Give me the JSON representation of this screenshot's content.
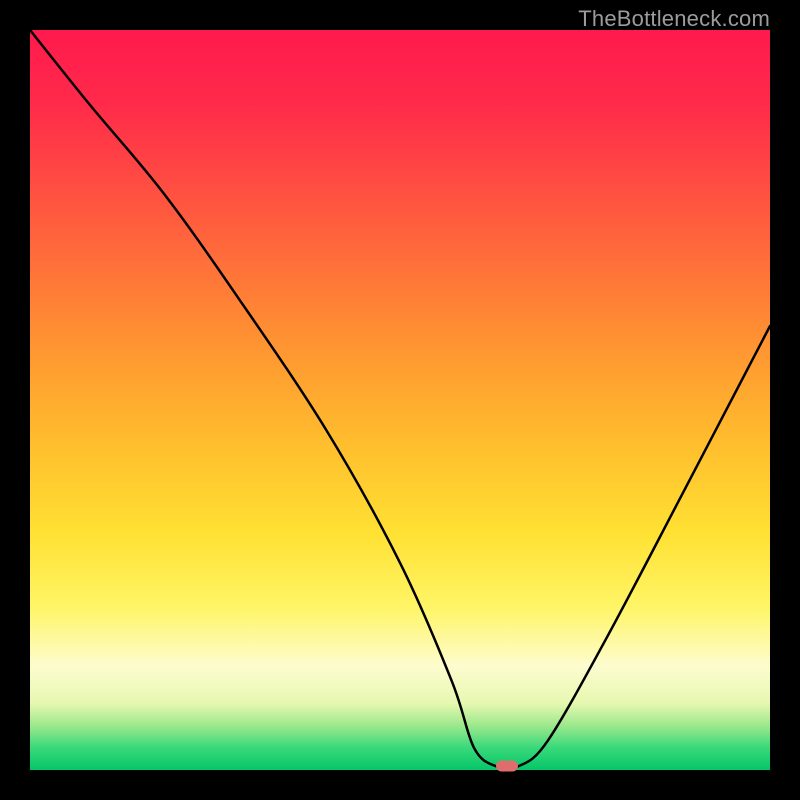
{
  "watermark": "TheBottleneck.com",
  "chart_data": {
    "type": "line",
    "title": "",
    "xlabel": "",
    "ylabel": "",
    "xlim": [
      0,
      100
    ],
    "ylim": [
      0,
      100
    ],
    "grid": false,
    "legend": false,
    "background_gradient": {
      "direction": "vertical",
      "stops": [
        {
          "pos": 0,
          "color": "#ff1a4d"
        },
        {
          "pos": 25,
          "color": "#ff5a3f"
        },
        {
          "pos": 55,
          "color": "#ffbb2d"
        },
        {
          "pos": 78,
          "color": "#fff566"
        },
        {
          "pos": 91,
          "color": "#e6f8b0"
        },
        {
          "pos": 100,
          "color": "#05c668"
        }
      ]
    },
    "series": [
      {
        "name": "bottleneck-curve",
        "color": "#000000",
        "x": [
          0,
          8,
          18,
          28,
          40,
          50,
          57,
          60,
          63,
          66,
          70,
          78,
          88,
          100
        ],
        "y": [
          100,
          90,
          78,
          64,
          46,
          28,
          12,
          3,
          0.5,
          0.5,
          4,
          18,
          37,
          60
        ]
      }
    ],
    "marker": {
      "x": 64.5,
      "y": 0.5,
      "color": "#e06d6d",
      "shape": "pill"
    }
  }
}
